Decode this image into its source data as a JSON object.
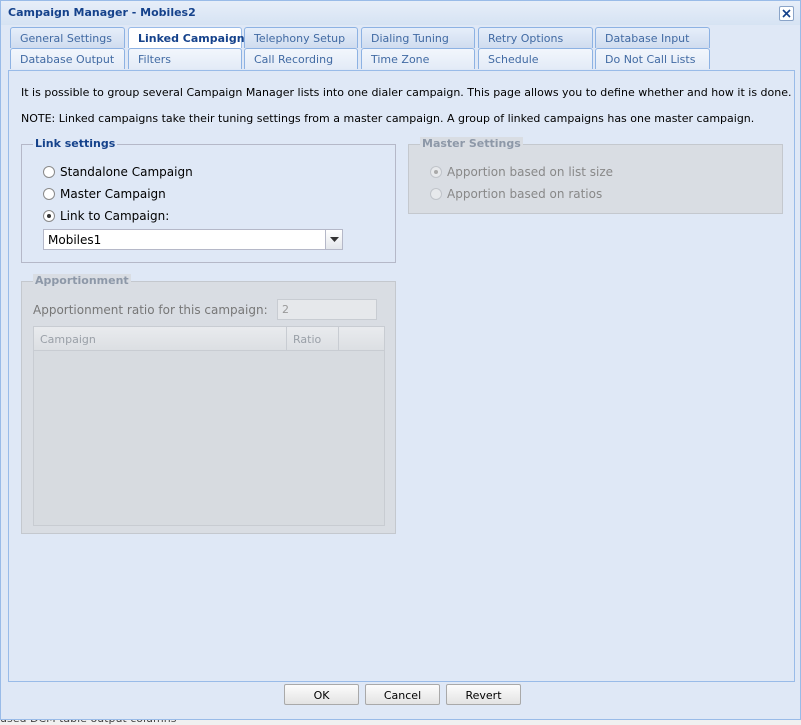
{
  "window": {
    "title": "Campaign Manager - Mobiles2"
  },
  "tabs": {
    "row1": [
      "General Settings",
      "Linked Campaign",
      "Telephony Setup",
      "Dialing Tuning",
      "Retry Options",
      "Database Input"
    ],
    "row2": [
      "Database Output",
      "Filters",
      "Call Recording",
      "Time Zone",
      "Schedule",
      "Do Not Call Lists"
    ],
    "active": "Linked Campaign"
  },
  "info": {
    "line1": "It is possible to group several Campaign Manager lists into one dialer campaign. This page allows you to define whether and how it is done.",
    "line2": "NOTE: Linked campaigns take their tuning settings from a master campaign. A group of linked campaigns has one master campaign."
  },
  "link_settings": {
    "legend": "Link settings",
    "options": [
      "Standalone Campaign",
      "Master Campaign",
      "Link to Campaign:"
    ],
    "selected": "Link to Campaign:",
    "campaign_value": "Mobiles1"
  },
  "master_settings": {
    "legend": "Master Settings",
    "options": [
      "Apportion based on list size",
      "Apportion based on ratios"
    ],
    "selected": "Apportion based on list size"
  },
  "apportionment": {
    "legend": "Apportionment",
    "ratio_label": "Apportionment ratio for this campaign:",
    "ratio_value": "2",
    "columns": [
      "Campaign",
      "Ratio"
    ]
  },
  "buttons": {
    "ok": "OK",
    "cancel": "Cancel",
    "revert": "Revert"
  },
  "background_text": "used DCM table output columns"
}
